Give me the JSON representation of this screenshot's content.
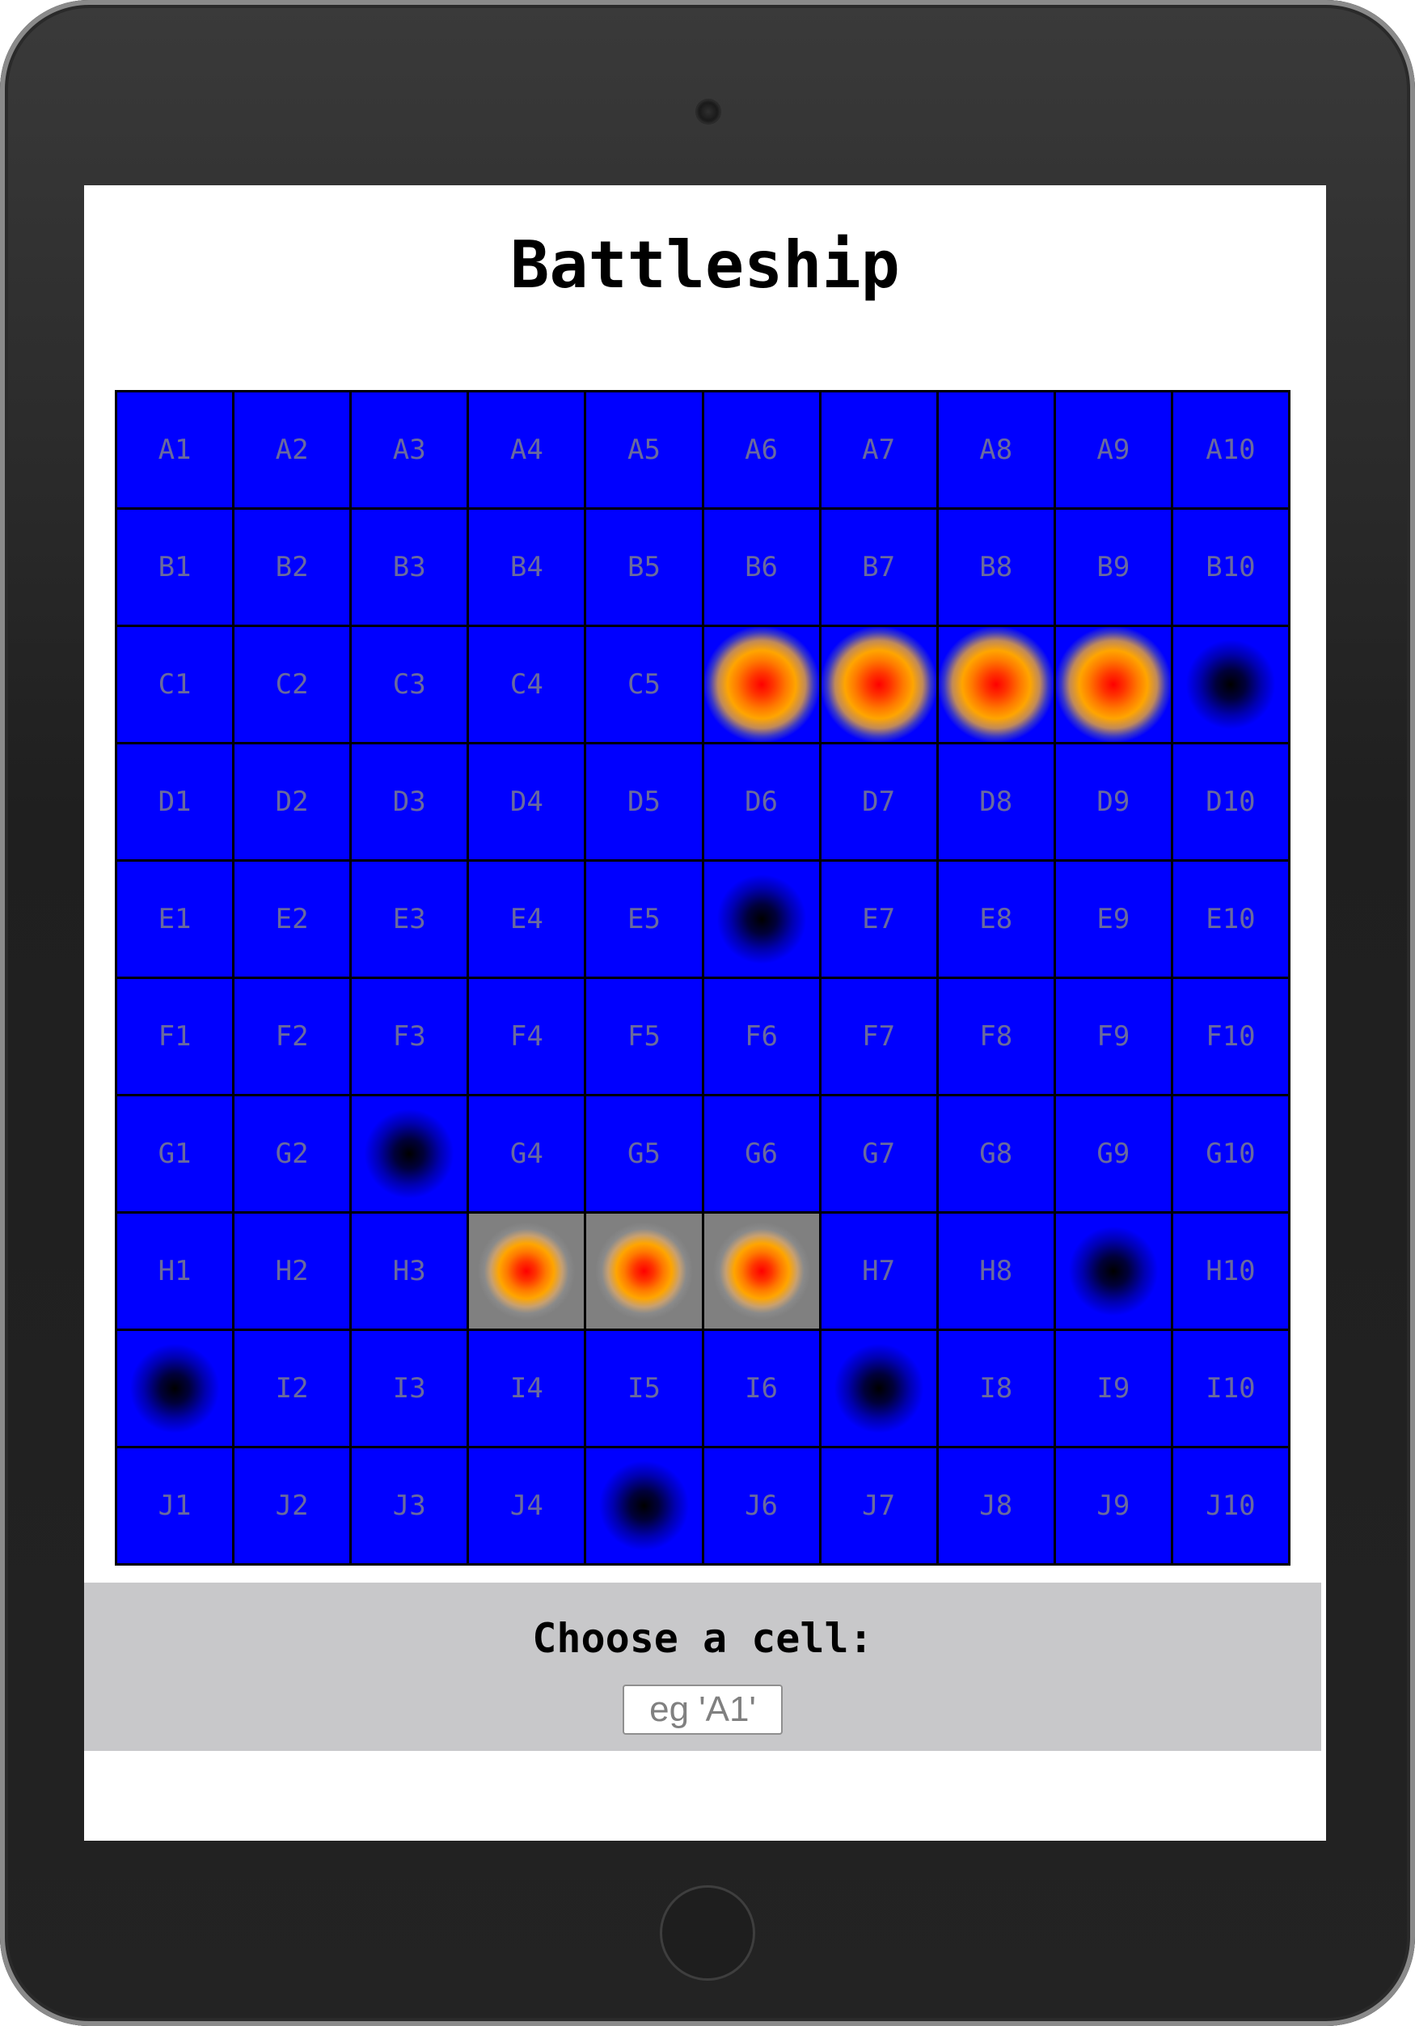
{
  "title": "Battleship",
  "controls": {
    "prompt": "Choose a cell:",
    "input_placeholder": "eg 'A1'",
    "input_value": ""
  },
  "colors": {
    "water": "#0000ff",
    "label": "#6a6a9e",
    "grid_line": "#000000",
    "hit_core": "#ff0000",
    "hit_ring": "#ffa500",
    "sunk_background": "#808080",
    "panel": "#c8c8ca"
  },
  "board": {
    "rows": [
      "A",
      "B",
      "C",
      "D",
      "E",
      "F",
      "G",
      "H",
      "I",
      "J"
    ],
    "columns": [
      1,
      2,
      3,
      4,
      5,
      6,
      7,
      8,
      9,
      10
    ],
    "hits": [
      "C6",
      "C7",
      "C8",
      "C9"
    ],
    "sunk": [
      "H4",
      "H5",
      "H6"
    ],
    "misses": [
      "C10",
      "E6",
      "G3",
      "H9",
      "I1",
      "I7",
      "J5"
    ]
  }
}
